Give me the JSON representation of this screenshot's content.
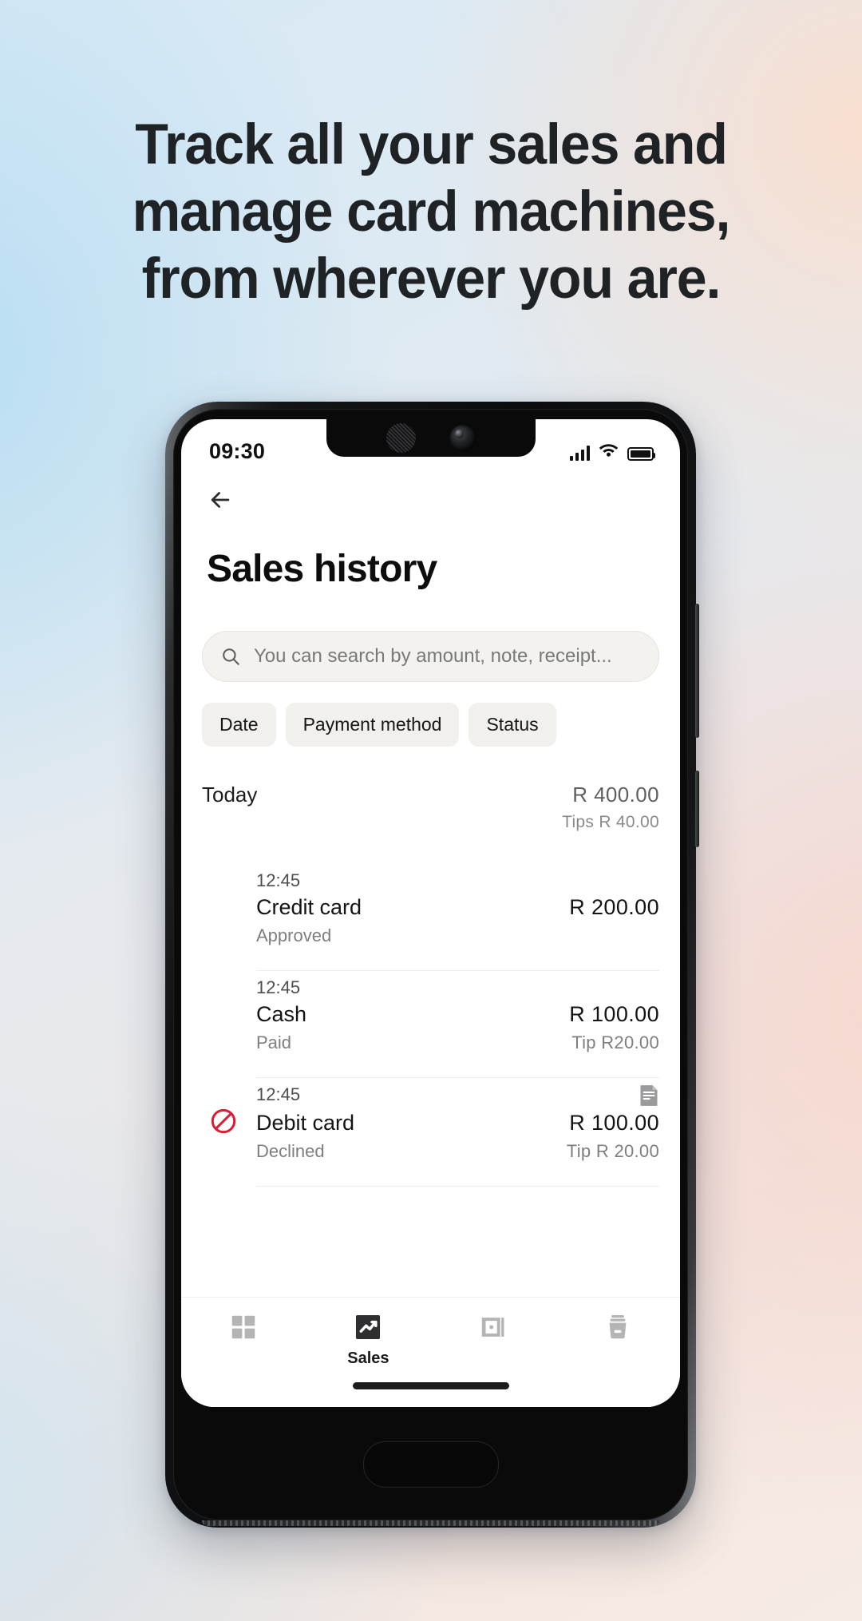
{
  "marketing": {
    "headline_lines": [
      "Track all your sales and",
      "manage card machines,",
      "from wherever you are."
    ]
  },
  "phone": {
    "status_bar": {
      "time": "09:30",
      "icons": [
        "signal-icon",
        "wifi-icon",
        "battery-icon"
      ]
    },
    "screen": {
      "back_button_icon": "back-arrow-icon",
      "title": "Sales history",
      "search": {
        "icon": "search-icon",
        "placeholder": "You can search by amount, note, receipt...",
        "value": ""
      },
      "filters": [
        {
          "label": "Date"
        },
        {
          "label": "Payment method"
        },
        {
          "label": "Status"
        }
      ],
      "day_group": {
        "label": "Today",
        "total": "R 400.00",
        "tips": "Tips R 40.00"
      },
      "transactions": [
        {
          "time": "12:45",
          "method": "Credit card",
          "status": "Approved",
          "amount": "R 200.00",
          "tip": "",
          "has_status_icon": false,
          "has_note_icon": false
        },
        {
          "time": "12:45",
          "method": "Cash",
          "status": "Paid",
          "amount": "R 100.00",
          "tip": "Tip R20.00",
          "has_status_icon": false,
          "has_note_icon": false
        },
        {
          "time": "12:45",
          "method": "Debit card",
          "status": "Declined",
          "amount": "R 100.00",
          "tip": "Tip R 20.00",
          "has_status_icon": true,
          "status_icon": "declined-icon",
          "has_note_icon": true,
          "note_icon": "note-icon"
        }
      ],
      "bottom_nav": [
        {
          "icon": "grid-dashboard-icon",
          "label": "",
          "active": false
        },
        {
          "icon": "sales-chart-icon",
          "label": "Sales",
          "active": true
        },
        {
          "icon": "card-wallet-icon",
          "label": "",
          "active": false
        },
        {
          "icon": "card-machine-icon",
          "label": "",
          "active": false
        }
      ]
    }
  },
  "colors": {
    "declined_red": "#e01a33",
    "active_nav": "#2f2f31",
    "inactive_nav": "#b4b4b4",
    "chip_bg": "#f1f0ed",
    "search_bg": "#f3f2ef"
  }
}
